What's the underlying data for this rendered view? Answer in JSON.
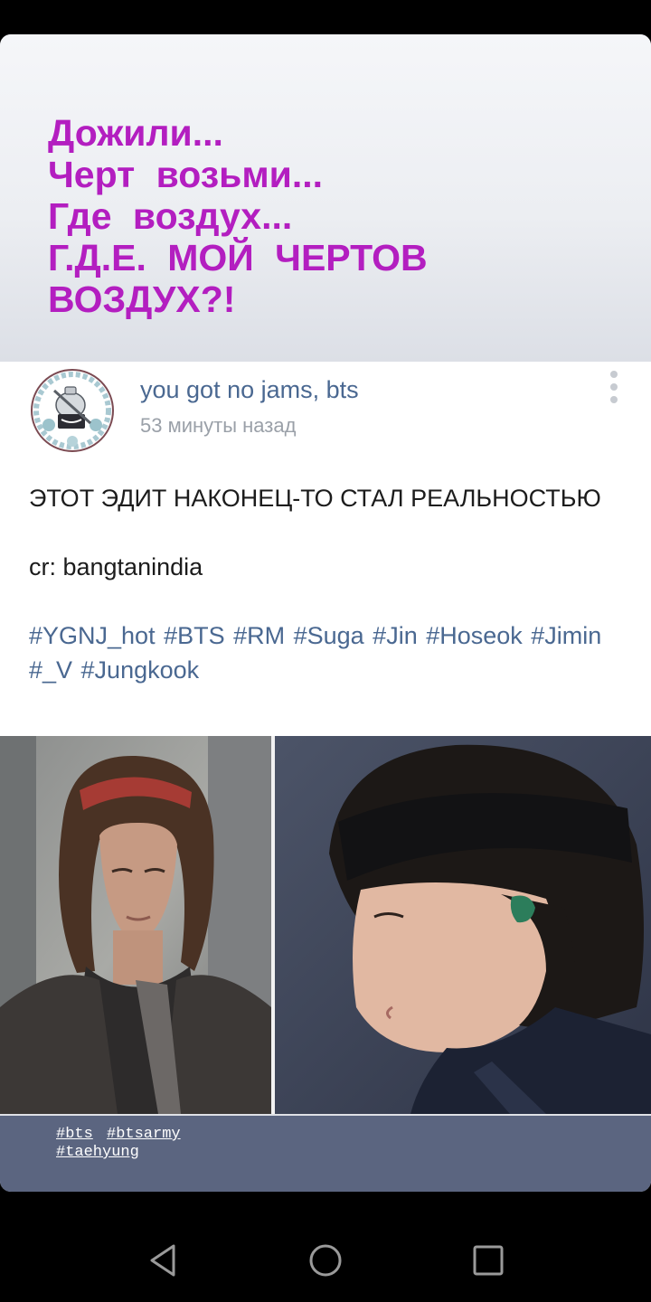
{
  "story": {
    "caption_lines": [
      "Дожили...",
      "Черт  возьми...",
      "Где  воздух...",
      "Г.Д.Е.  МОЙ  ЧЕРТОВ",
      "ВОЗДУХ?!"
    ],
    "caption_color": "#b31ec0",
    "story_tags": [
      "#bts",
      "#btsarmy",
      "#taehyung"
    ]
  },
  "post": {
    "author": "you got no jams, bts",
    "time": "53 минуты назад",
    "headline": "ЭТОТ ЭДИТ НАКОНЕЦ-ТО СТАЛ РЕАЛЬНОСТЬЮ",
    "credit": "cr: bangtanindia",
    "hashtags": "#YGNJ_hot #BTS #RM #Suga #Jin #Hoseok #Jimin #_V #Jungkook",
    "link_color": "#4a6891",
    "more_icon": "vertical-dots-icon"
  },
  "photos": [
    {
      "icon": "photo-left"
    },
    {
      "icon": "photo-right"
    }
  ],
  "nav": {
    "back_icon": "back-triangle-icon",
    "home_icon": "home-circle-icon",
    "recents_icon": "recents-square-icon"
  }
}
